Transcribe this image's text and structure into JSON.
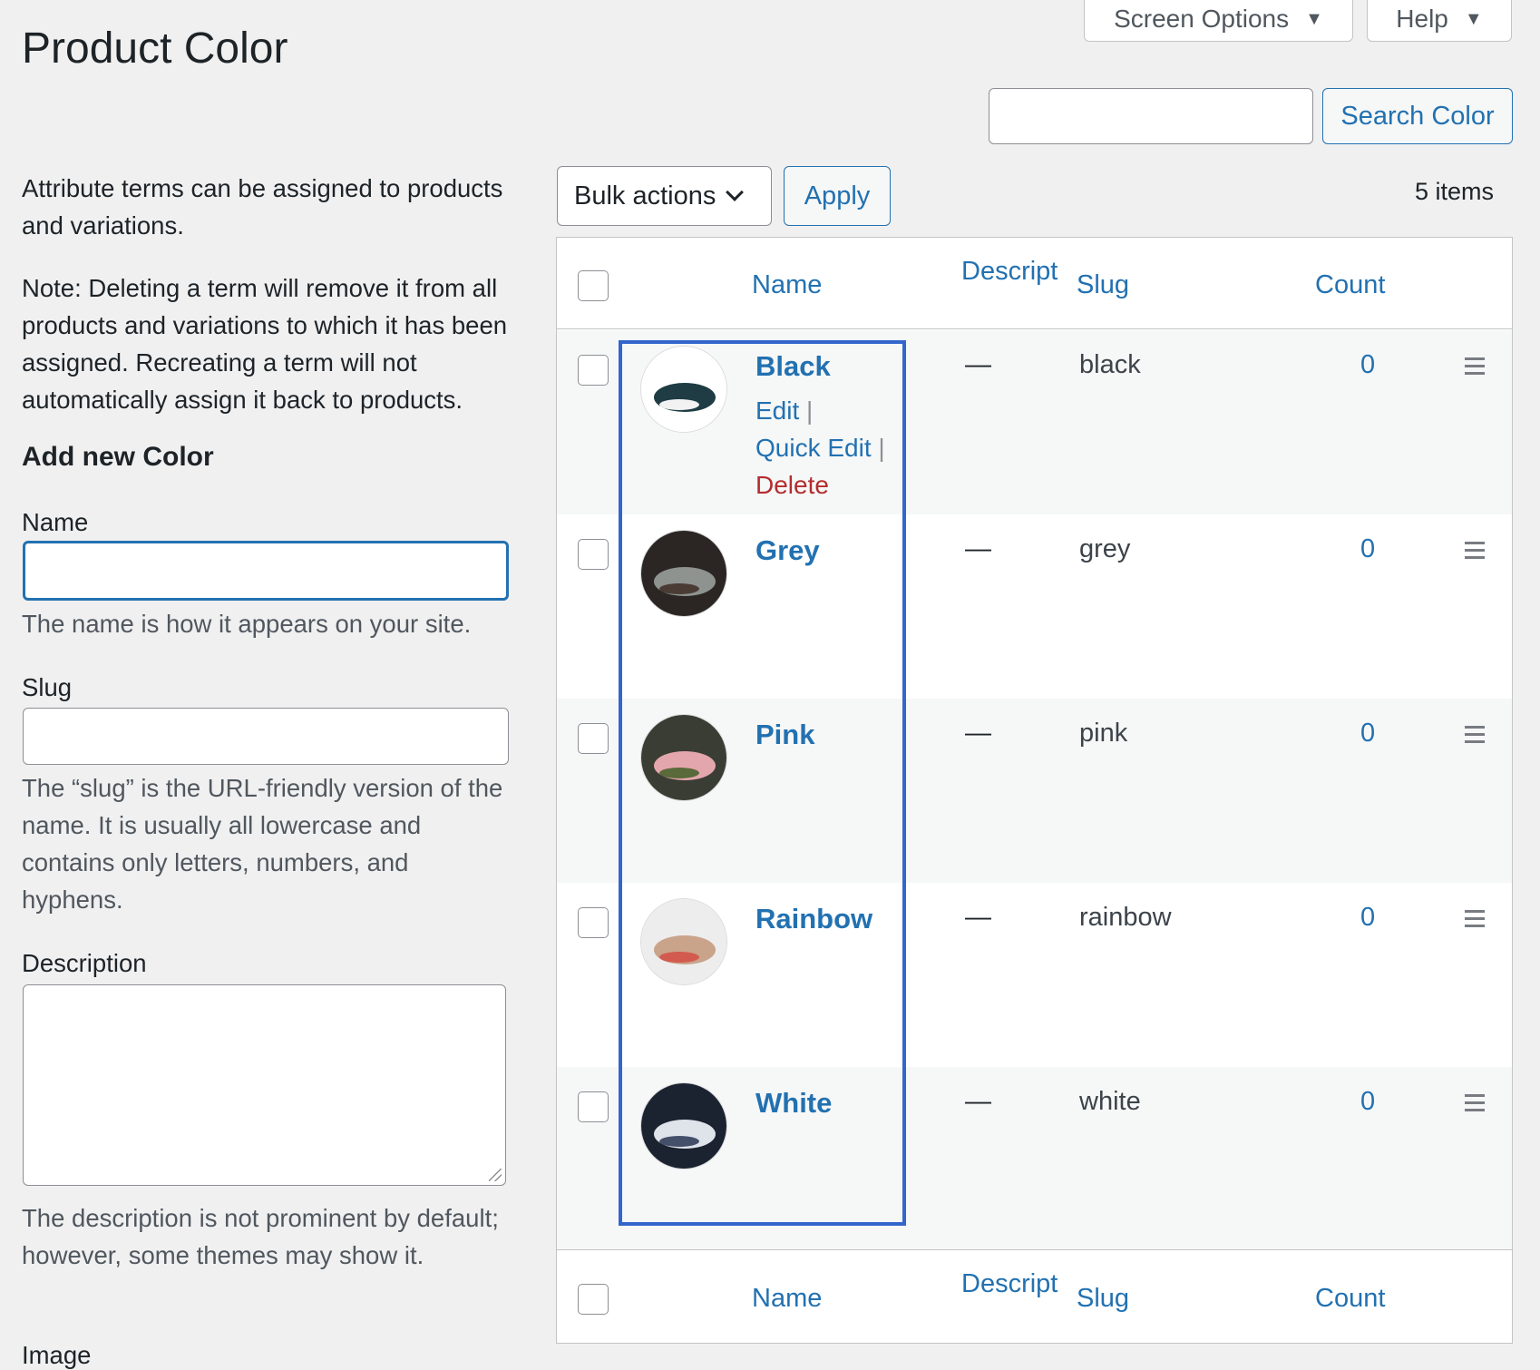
{
  "header": {
    "title": "Product Color",
    "screen_options_label": "Screen Options",
    "help_label": "Help"
  },
  "search": {
    "value": "",
    "button_label": "Search Color"
  },
  "left": {
    "intro": "Attribute terms can be assigned to products and variations.",
    "note": "Note: Deleting a term will remove it from all products and variations to which it has been assigned. Recreating a term will not automatically assign it back to products.",
    "add_title": "Add new Color",
    "name_label": "Name",
    "name_value": "",
    "name_help": "The name is how it appears on your site.",
    "slug_label": "Slug",
    "slug_value": "",
    "slug_help": "The “slug” is the URL-friendly version of the name. It is usually all lowercase and contains only letters, numbers, and hyphens.",
    "description_label": "Description",
    "description_value": "",
    "description_help": "The description is not prominent by default; however, some themes may show it.",
    "image_label": "Image"
  },
  "bulk": {
    "selected": "Bulk actions",
    "apply_label": "Apply",
    "items_count": "5 items"
  },
  "table": {
    "columns": {
      "name": "Name",
      "description": "Descript",
      "slug": "Slug",
      "count": "Count"
    },
    "row_actions": {
      "edit": "Edit",
      "quick_edit": "Quick Edit",
      "delete": "Delete",
      "separator": "|"
    },
    "rows": [
      {
        "name": "Black",
        "description": "—",
        "slug": "black",
        "count": "0",
        "thumb_colors": [
          "#ffffff",
          "#1f3b43",
          "#f2f2f2"
        ]
      },
      {
        "name": "Grey",
        "description": "—",
        "slug": "grey",
        "count": "0",
        "thumb_colors": [
          "#2b2623",
          "#8e9390",
          "#4a3c34"
        ]
      },
      {
        "name": "Pink",
        "description": "—",
        "slug": "pink",
        "count": "0",
        "thumb_colors": [
          "#3a3d34",
          "#e4a6ad",
          "#5a6a3a"
        ]
      },
      {
        "name": "Rainbow",
        "description": "—",
        "slug": "rainbow",
        "count": "0",
        "thumb_colors": [
          "#ededed",
          "#c9a38a",
          "#d35a4f"
        ]
      },
      {
        "name": "White",
        "description": "—",
        "slug": "white",
        "count": "0",
        "thumb_colors": [
          "#1b2330",
          "#dfe3ea",
          "#44506a"
        ]
      }
    ]
  },
  "colors": {
    "accent": "#2271b1",
    "delete": "#b32d2e",
    "highlight_border": "#3366cc",
    "background": "#f0f0f1"
  }
}
